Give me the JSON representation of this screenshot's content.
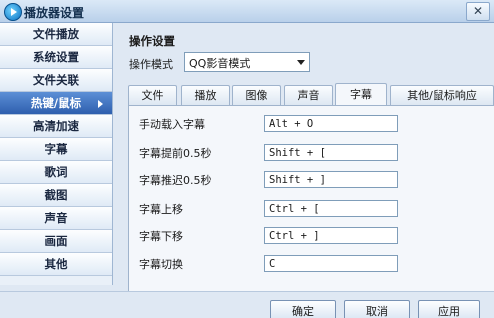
{
  "window": {
    "title": "播放器设置",
    "close_glyph": "✕"
  },
  "sidebar": {
    "items": [
      {
        "label": "文件播放"
      },
      {
        "label": "系统设置"
      },
      {
        "label": "文件关联"
      },
      {
        "label": "热键/鼠标",
        "active": true
      },
      {
        "label": "高清加速"
      },
      {
        "label": "字幕"
      },
      {
        "label": "歌词"
      },
      {
        "label": "截图"
      },
      {
        "label": "声音"
      },
      {
        "label": "画面"
      },
      {
        "label": "其他"
      }
    ]
  },
  "panel": {
    "section_title": "操作设置",
    "mode_label": "操作模式",
    "mode_value": "QQ影音模式",
    "tabs": [
      {
        "label": "文件"
      },
      {
        "label": "播放"
      },
      {
        "label": "图像"
      },
      {
        "label": "声音"
      },
      {
        "label": "字幕",
        "active": true
      },
      {
        "label": "其他/鼠标响应"
      }
    ],
    "rows": [
      {
        "label": "手动载入字幕",
        "value": "Alt + O"
      },
      {
        "label": "字幕提前0.5秒",
        "value": "Shift + ["
      },
      {
        "label": "字幕推迟0.5秒",
        "value": "Shift + ]"
      },
      {
        "label": "字幕上移",
        "value": "Ctrl + ["
      },
      {
        "label": "字幕下移",
        "value": "Ctrl + ]"
      },
      {
        "label": "字幕切换",
        "value": "C"
      }
    ]
  },
  "footer": {
    "ok": "确定",
    "cancel": "取消",
    "apply": "应用"
  }
}
